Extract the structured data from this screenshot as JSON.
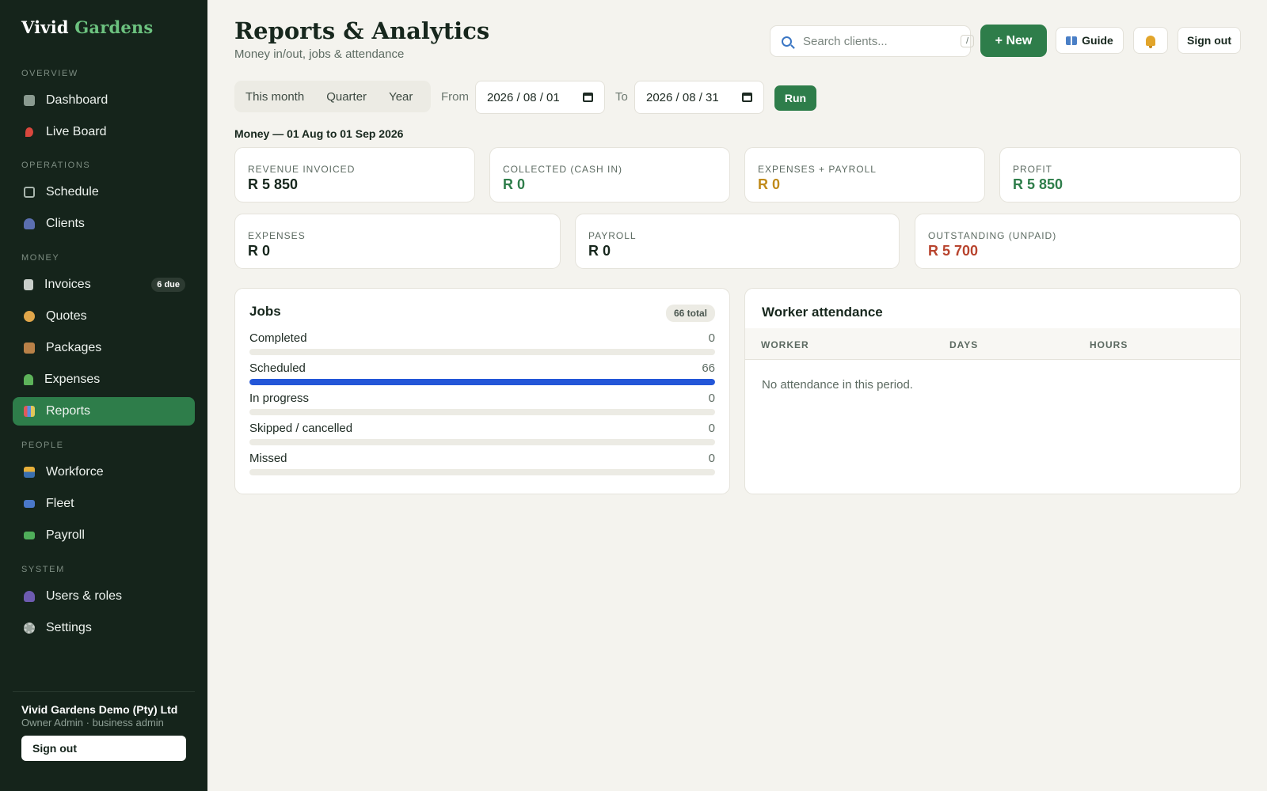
{
  "sidebar": {
    "brand_main": "Vivid",
    "brand_accent": "Gardens",
    "sections": {
      "overview": "OVERVIEW",
      "operations": "OPERATIONS",
      "money": "MONEY",
      "people": "PEOPLE",
      "system": "SYSTEM"
    },
    "items": {
      "dashboard": "Dashboard",
      "live_board": "Live Board",
      "schedule": "Schedule",
      "clients": "Clients",
      "invoices": "Invoices",
      "invoices_badge": "6 due",
      "quotes": "Quotes",
      "packages": "Packages",
      "expenses": "Expenses",
      "reports": "Reports",
      "workforce": "Workforce",
      "fleet": "Fleet",
      "payroll": "Payroll",
      "users_roles": "Users & roles",
      "settings": "Settings"
    },
    "org_name": "Vivid Gardens Demo (Pty) Ltd",
    "org_sub": "Owner Admin · business admin",
    "sign_out": "Sign out"
  },
  "header": {
    "title": "Reports & Analytics",
    "subtitle": "Money in/out, jobs & attendance",
    "search_placeholder": "Search clients...",
    "search_shortcut": "/",
    "new_label": "+ New",
    "guide_label": "Guide",
    "sign_out": "Sign out"
  },
  "filters": {
    "segments": [
      "This month",
      "Quarter",
      "Year"
    ],
    "from_label": "From",
    "from_value": "2026 / 08 / 01",
    "to_label": "To",
    "to_value": "2026 / 08 / 31",
    "run_label": "Run"
  },
  "period_label": "Money — 01 Aug to 01 Sep 2026",
  "stats": {
    "revenue_invoiced": {
      "label": "REVENUE INVOICED",
      "value": "R 5 850"
    },
    "collected": {
      "label": "COLLECTED (CASH IN)",
      "value": "R 0"
    },
    "expenses_payroll": {
      "label": "EXPENSES + PAYROLL",
      "value": "R 0"
    },
    "profit": {
      "label": "PROFIT",
      "value": "R 5 850"
    },
    "expenses": {
      "label": "EXPENSES",
      "value": "R 0"
    },
    "payroll": {
      "label": "PAYROLL",
      "value": "R 0"
    },
    "outstanding": {
      "label": "OUTSTANDING (UNPAID)",
      "value": "R 5 700"
    }
  },
  "jobs": {
    "title": "Jobs",
    "total_badge": "66 total",
    "total": 66,
    "rows": [
      {
        "label": "Completed",
        "count": 0
      },
      {
        "label": "Scheduled",
        "count": 66
      },
      {
        "label": "In progress",
        "count": 0
      },
      {
        "label": "Skipped / cancelled",
        "count": 0
      },
      {
        "label": "Missed",
        "count": 0
      }
    ]
  },
  "attendance": {
    "title": "Worker attendance",
    "columns": [
      "WORKER",
      "DAYS",
      "HOURS"
    ],
    "empty_text": "No attendance in this period."
  },
  "colors": {
    "accent_green": "#2e7d4a",
    "positive": "#2e7d4a",
    "warning": "#c08a1a",
    "negative": "#b8442e",
    "progress_blue": "#2356d8"
  }
}
